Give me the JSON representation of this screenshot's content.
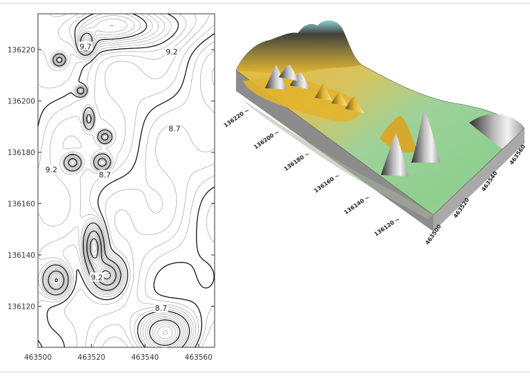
{
  "chart_data": [
    {
      "type": "contour",
      "x_ticks": [
        463500,
        463520,
        463540,
        463560
      ],
      "y_ticks": [
        136120,
        136140,
        136160,
        136180,
        136200,
        136220
      ],
      "xlim": [
        463500,
        463566
      ],
      "ylim": [
        136104,
        136234
      ],
      "contour_labels": [
        {
          "text": "9.7",
          "x": 463517.8,
          "y": 136221
        },
        {
          "text": "9.2",
          "x": 463550,
          "y": 136219
        },
        {
          "text": "8.7",
          "x": 463551,
          "y": 136189
        },
        {
          "text": "9.2",
          "x": 463505,
          "y": 136173
        },
        {
          "text": "8.7",
          "x": 463525,
          "y": 136171
        },
        {
          "text": "8.7",
          "x": 463546,
          "y": 136119
        },
        {
          "text": "9.2",
          "x": 463522,
          "y": 136131
        }
      ],
      "grid": false
    },
    {
      "type": "surface3d",
      "y_axis_ticks": [
        136120,
        136140,
        136160,
        136180,
        136200,
        136220
      ],
      "x_axis_ticks": [
        463500,
        463520,
        463540,
        463560
      ],
      "colors": {
        "high": "#4a4a4a",
        "mid": "#e8b830",
        "low": "#8fcf8f",
        "peak_tip": "#7fd3df"
      }
    }
  ]
}
